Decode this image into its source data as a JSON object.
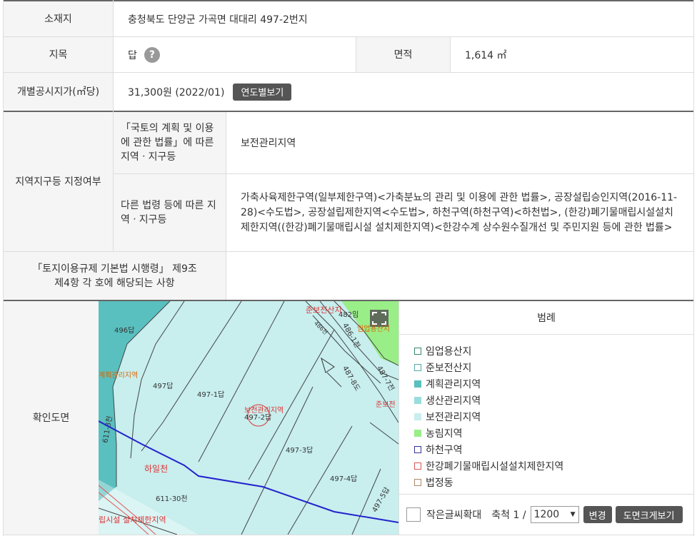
{
  "location": {
    "label": "소재지",
    "value": "충청북도 단양군 가곡면 대대리 497-2번지"
  },
  "land": {
    "jimok_label": "지목",
    "jimok_value": "답",
    "help_icon": "?",
    "area_label": "면적",
    "area_value": "1,614 ㎡"
  },
  "price": {
    "label": "개별공시지가(㎡당)",
    "value": "31,300원 (2022/01)",
    "button": "연도별보기"
  },
  "zoning": {
    "section_label": "지역지구등 지정여부",
    "national_label": "「국토의 계획 및 이용에 관한 법률」에 따른 지역ㆍ지구등",
    "national_value": "보전관리지역",
    "other_label": "다른 법령 등에 따른 지역ㆍ지구등",
    "other_value": "가축사육제한구역(일부제한구역)<가축분뇨의 관리 및 이용에 관한 법률>, 공장설립승인지역(2016-11-28)<수도법>, 공장설립제한지역<수도법>, 하천구역(하천구역)<하천법>, (한강)폐기물매립시설설치제한지역((한강)폐기물매립시설 설치제한지역)<한강수계 상수원수질개선 및 주민지원 등에 관한 법률>"
  },
  "enforcement": {
    "label": "「토지이용규제 기본법 시행령」 제9조 제4항 각 호에 해당되는 사항",
    "value": ""
  },
  "map_section": {
    "label": "확인도면"
  },
  "map": {
    "labels": {
      "p496": "496답",
      "p497": "497답",
      "p497_1": "497-1답",
      "p497_2": "497-2답",
      "p497_3": "497-3답",
      "p497_4": "497-4답",
      "p497_5": "497-5답",
      "p611_30": "611-30천",
      "p611_3": "611-3천",
      "p487_8": "487-8도",
      "p486_1": "486-1전",
      "p487_7": "487-7전",
      "p482": "482임",
      "p486": "486천",
      "zone_conservation": "보전관리지역",
      "zone_planning": "계획관리지역",
      "zone_semi": "준보전산지",
      "zone_forest": "임업용산지",
      "zone_semi2": "준보전",
      "river": "하일천",
      "restrict": "립시설 설치제한지역"
    },
    "colors": {
      "conservation": "#c8eeee",
      "planning": "#5abfbf",
      "forest": "#99ee88",
      "restrict": "#dd5555",
      "river": "#2222cc"
    }
  },
  "legend": {
    "title": "범례",
    "items": [
      {
        "label": "임업용산지",
        "border": "#338866",
        "fill": "#ffffff"
      },
      {
        "label": "준보전산지",
        "border": "#55aaaa",
        "fill": "#ffffff"
      },
      {
        "label": "계획관리지역",
        "border": "#5abfbf",
        "fill": "#5abfbf"
      },
      {
        "label": "생산관리지역",
        "border": "#99dddd",
        "fill": "#99dddd"
      },
      {
        "label": "보전관리지역",
        "border": "#c8eeee",
        "fill": "#c8eeee"
      },
      {
        "label": "농림지역",
        "border": "#99ee88",
        "fill": "#99ee88"
      },
      {
        "label": "하천구역",
        "border": "#333399",
        "fill": "#ffffff"
      },
      {
        "label": "한강폐기물매립시설설치제한지역",
        "border": "#dd5555",
        "fill": "#ffffff"
      },
      {
        "label": "법정동",
        "border": "#aa8866",
        "fill": "#ffffff"
      }
    ]
  },
  "map_controls": {
    "small_text_label": "작은글씨확대",
    "scale_label": "축척 1 /",
    "scale_value": "1200",
    "scale_options": [
      "1200"
    ],
    "change_button": "변경",
    "enlarge_button": "도면크게보기"
  }
}
